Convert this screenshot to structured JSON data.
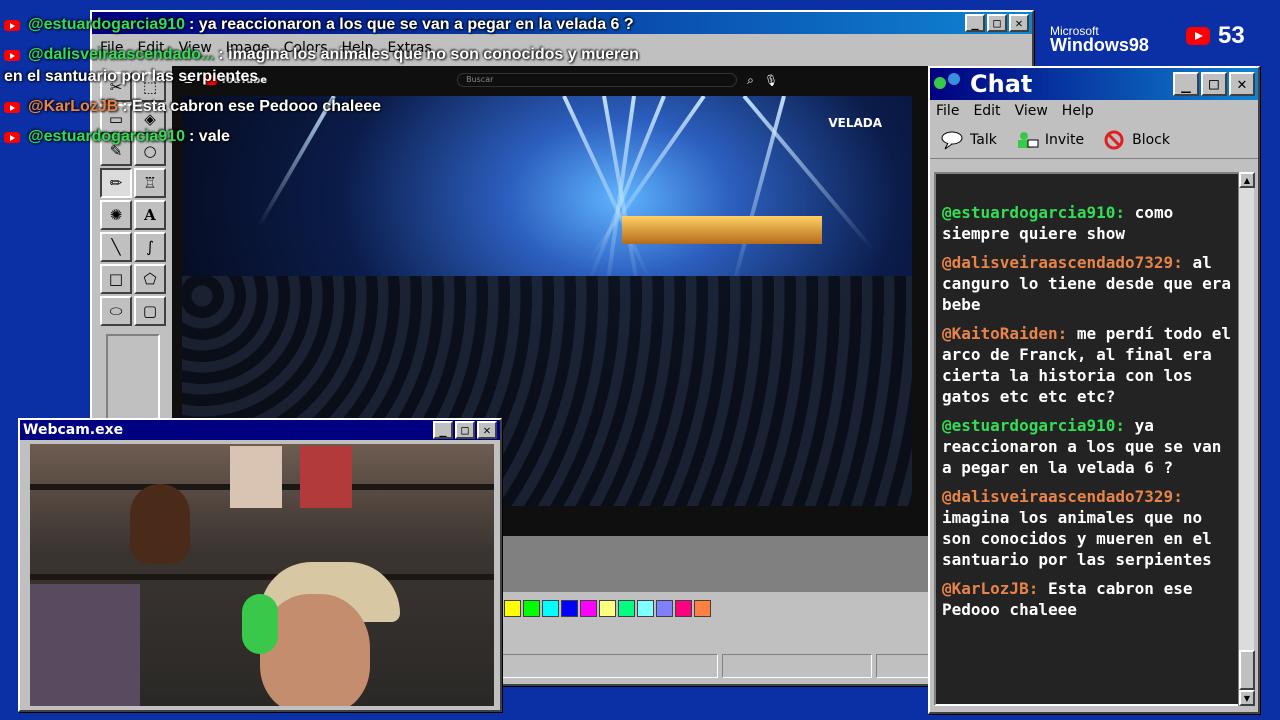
{
  "overlay_chat": [
    {
      "user": "@estuardogarcia910",
      "text": ": ya reaccionaron a los que se van a pegar en la velada 6 ?",
      "color": "#33dd55"
    },
    {
      "user": "@dalisveiraascendado...",
      "text": ": imagina los animales que no son conocidos y mueren",
      "text2": "en el santuario por las serpientes",
      "color": "#33dd55"
    },
    {
      "user": "@KarLozJB",
      "text": ": Esta cabron ese Pedooo chaleee",
      "color": "#e8844a"
    },
    {
      "user": "@estuardogarcia910",
      "text": ": vale",
      "color": "#33dd55"
    }
  ],
  "paint": {
    "menu": [
      "File",
      "Edit",
      "View",
      "Image",
      "Colors",
      "Help",
      "Extras"
    ],
    "palette": [
      "#ffff00",
      "#00ff00",
      "#00ffff",
      "#0000ff",
      "#ff00ff",
      "#ffff80",
      "#00ff80",
      "#80ffff",
      "#8080ff",
      "#ff0080",
      "#ff8040"
    ]
  },
  "video": {
    "yt_logo": "YouTube",
    "search_placeholder": "Buscar",
    "event_logo": "VELADA"
  },
  "branding": {
    "microsoft": "Microsoft",
    "windows": "Windows98",
    "viewer_count": "53"
  },
  "chat_window": {
    "title": "Chat",
    "menu": [
      "File",
      "Edit",
      "View",
      "Help"
    ],
    "toolbar": [
      "Talk",
      "Invite",
      "Block"
    ],
    "messages": [
      {
        "user": "@estuardogarcia910:",
        "text": "como siempre quiere show",
        "color": "green"
      },
      {
        "user": "@dalisveiraascendado7329:",
        "text": "al canguro lo tiene desde que era bebe",
        "color": "orange"
      },
      {
        "user": "@KaitoRaiden:",
        "text": "me perdí todo el arco de Franck, al final era cierta la historia con los gatos etc etc etc?",
        "color": "orange"
      },
      {
        "user": "@estuardogarcia910:",
        "text": "ya reaccionaron a los que se van a pegar en la velada 6 ?",
        "color": "green"
      },
      {
        "user": "@dalisveiraascendado7329:",
        "text": "imagina los animales que no son conocidos y mueren en el santuario por las serpientes",
        "color": "orange"
      },
      {
        "user": "@KarLozJB:",
        "text": "Esta cabron ese Pedooo chaleee",
        "color": "orange"
      }
    ]
  },
  "webcam": {
    "title": "Webcam.exe"
  }
}
